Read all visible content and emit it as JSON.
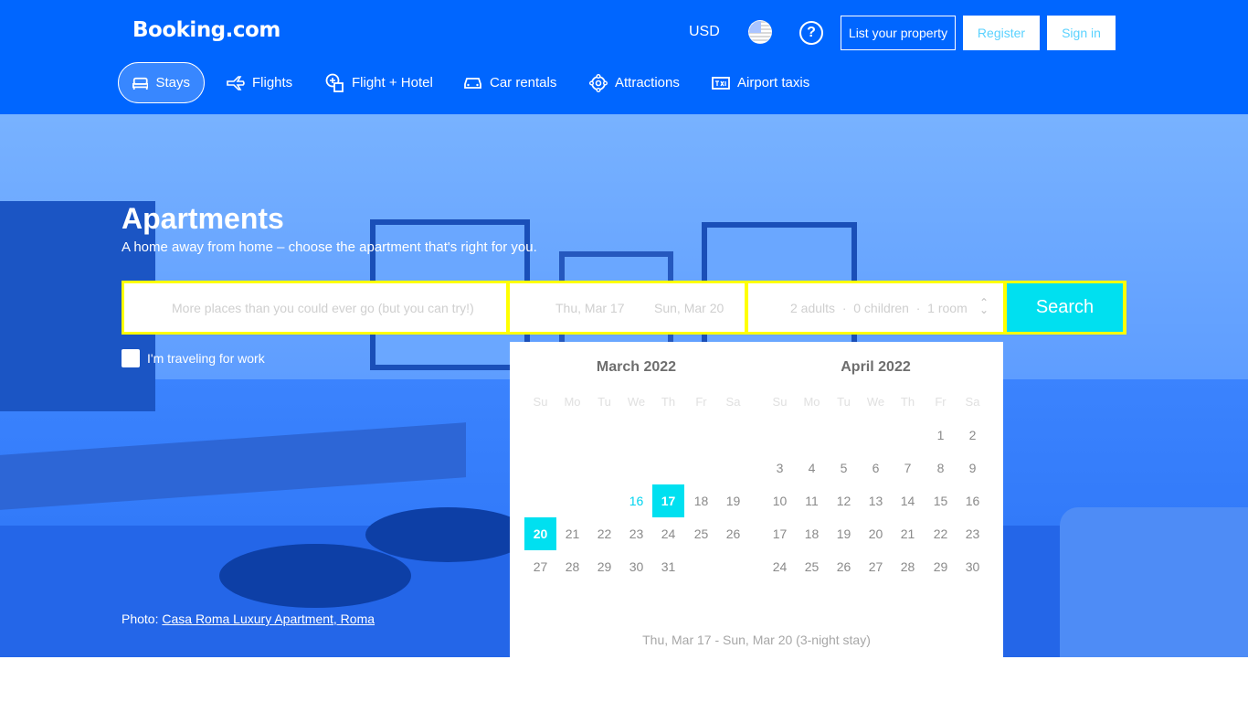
{
  "header": {
    "logo": "Booking.com",
    "currency": "USD",
    "help": "?",
    "list_property": "List your property",
    "register": "Register",
    "sign_in": "Sign in"
  },
  "nav": [
    {
      "label": "Stays",
      "icon": "bed-icon",
      "active": true
    },
    {
      "label": "Flights",
      "icon": "plane-icon",
      "active": false
    },
    {
      "label": "Flight + Hotel",
      "icon": "flight-hotel-icon",
      "active": false
    },
    {
      "label": "Car rentals",
      "icon": "car-icon",
      "active": false
    },
    {
      "label": "Attractions",
      "icon": "attractions-icon",
      "active": false
    },
    {
      "label": "Airport taxis",
      "icon": "taxi-icon",
      "active": false
    }
  ],
  "hero": {
    "title": "Apartments",
    "subtitle": "A home away from home – choose the apartment that's right for you.",
    "photo_label": "Photo:",
    "photo_link": "Casa Roma Luxury Apartment, Roma"
  },
  "search": {
    "destination_placeholder": "More places than you could ever go (but you can try!)",
    "check_in": "Thu, Mar 17",
    "check_out": "Sun, Mar 20",
    "guests": "2 adults  ·  0 children  ·  1 room",
    "button": "Search",
    "work_label": "I'm traveling for work"
  },
  "calendar": {
    "weekdays": [
      "Su",
      "Mo",
      "Tu",
      "We",
      "Th",
      "Fr",
      "Sa"
    ],
    "months": [
      {
        "title": "March 2022",
        "weeks": [
          [
            "",
            "",
            "",
            "16",
            "17",
            "18",
            "19"
          ],
          [
            "20",
            "21",
            "22",
            "23",
            "24",
            "25",
            "26"
          ],
          [
            "27",
            "28",
            "29",
            "30",
            "31",
            "",
            ""
          ]
        ]
      },
      {
        "title": "April 2022",
        "weeks": [
          [
            "",
            "",
            "",
            "",
            "",
            "1",
            "2"
          ],
          [
            "3",
            "4",
            "5",
            "6",
            "7",
            "8",
            "9"
          ],
          [
            "10",
            "11",
            "12",
            "13",
            "14",
            "15",
            "16"
          ],
          [
            "17",
            "18",
            "19",
            "20",
            "21",
            "22",
            "23"
          ],
          [
            "24",
            "25",
            "26",
            "27",
            "28",
            "29",
            "30"
          ]
        ]
      }
    ],
    "selected_start": "17",
    "selected_end": "20",
    "highlight": "16",
    "summary": "Thu, Mar 17 - Sun, Mar 20 (3-night stay)",
    "selected_color": "#00e0f0"
  },
  "colors": {
    "brand": "#0066ff",
    "accent": "#00e0f0",
    "search_border": "#ffff00"
  }
}
